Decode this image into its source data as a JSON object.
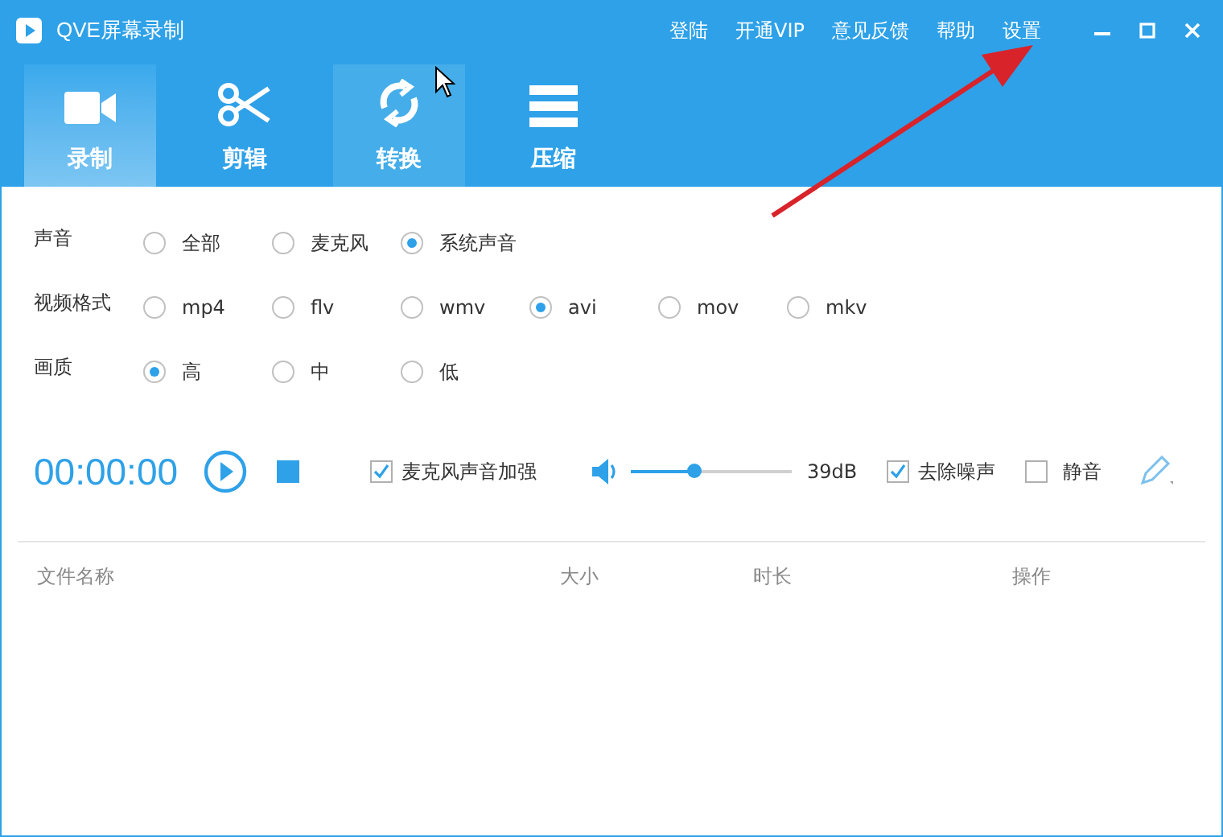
{
  "window": {
    "title": "QVE屏幕录制"
  },
  "top_links": [
    "登陆",
    "开通VIP",
    "意见反馈",
    "帮助",
    "设置"
  ],
  "tabs": [
    {
      "label": "录制",
      "kind": "camera",
      "selected": true,
      "hovered": false
    },
    {
      "label": "剪辑",
      "kind": "scissors",
      "selected": false,
      "hovered": false
    },
    {
      "label": "转换",
      "kind": "convert",
      "selected": false,
      "hovered": true
    },
    {
      "label": "压缩",
      "kind": "compress",
      "selected": false,
      "hovered": false
    }
  ],
  "settings": [
    {
      "label": "声音",
      "options": [
        {
          "label": "全部",
          "selected": false
        },
        {
          "label": "麦克风",
          "selected": false
        },
        {
          "label": "系统声音",
          "selected": true
        }
      ]
    },
    {
      "label": "视频格式",
      "options": [
        {
          "label": "mp4",
          "selected": false
        },
        {
          "label": "flv",
          "selected": false
        },
        {
          "label": "wmv",
          "selected": false
        },
        {
          "label": "avi",
          "selected": true
        },
        {
          "label": "mov",
          "selected": false
        },
        {
          "label": "mkv",
          "selected": false
        }
      ]
    },
    {
      "label": "画质",
      "options": [
        {
          "label": "高",
          "selected": true
        },
        {
          "label": "中",
          "selected": false
        },
        {
          "label": "低",
          "selected": false
        }
      ]
    }
  ],
  "recorder": {
    "time": "00:00:00",
    "mic_boost": {
      "label": "麦克风声音加强",
      "checked": true
    },
    "volume": {
      "level": 0.39,
      "reading": "39dB"
    },
    "denoise": {
      "label": "去除噪声",
      "checked": true
    },
    "mute": {
      "label": "静音",
      "checked": false
    }
  },
  "table": {
    "columns": [
      "文件名称",
      "大小",
      "时长",
      "操作"
    ]
  }
}
